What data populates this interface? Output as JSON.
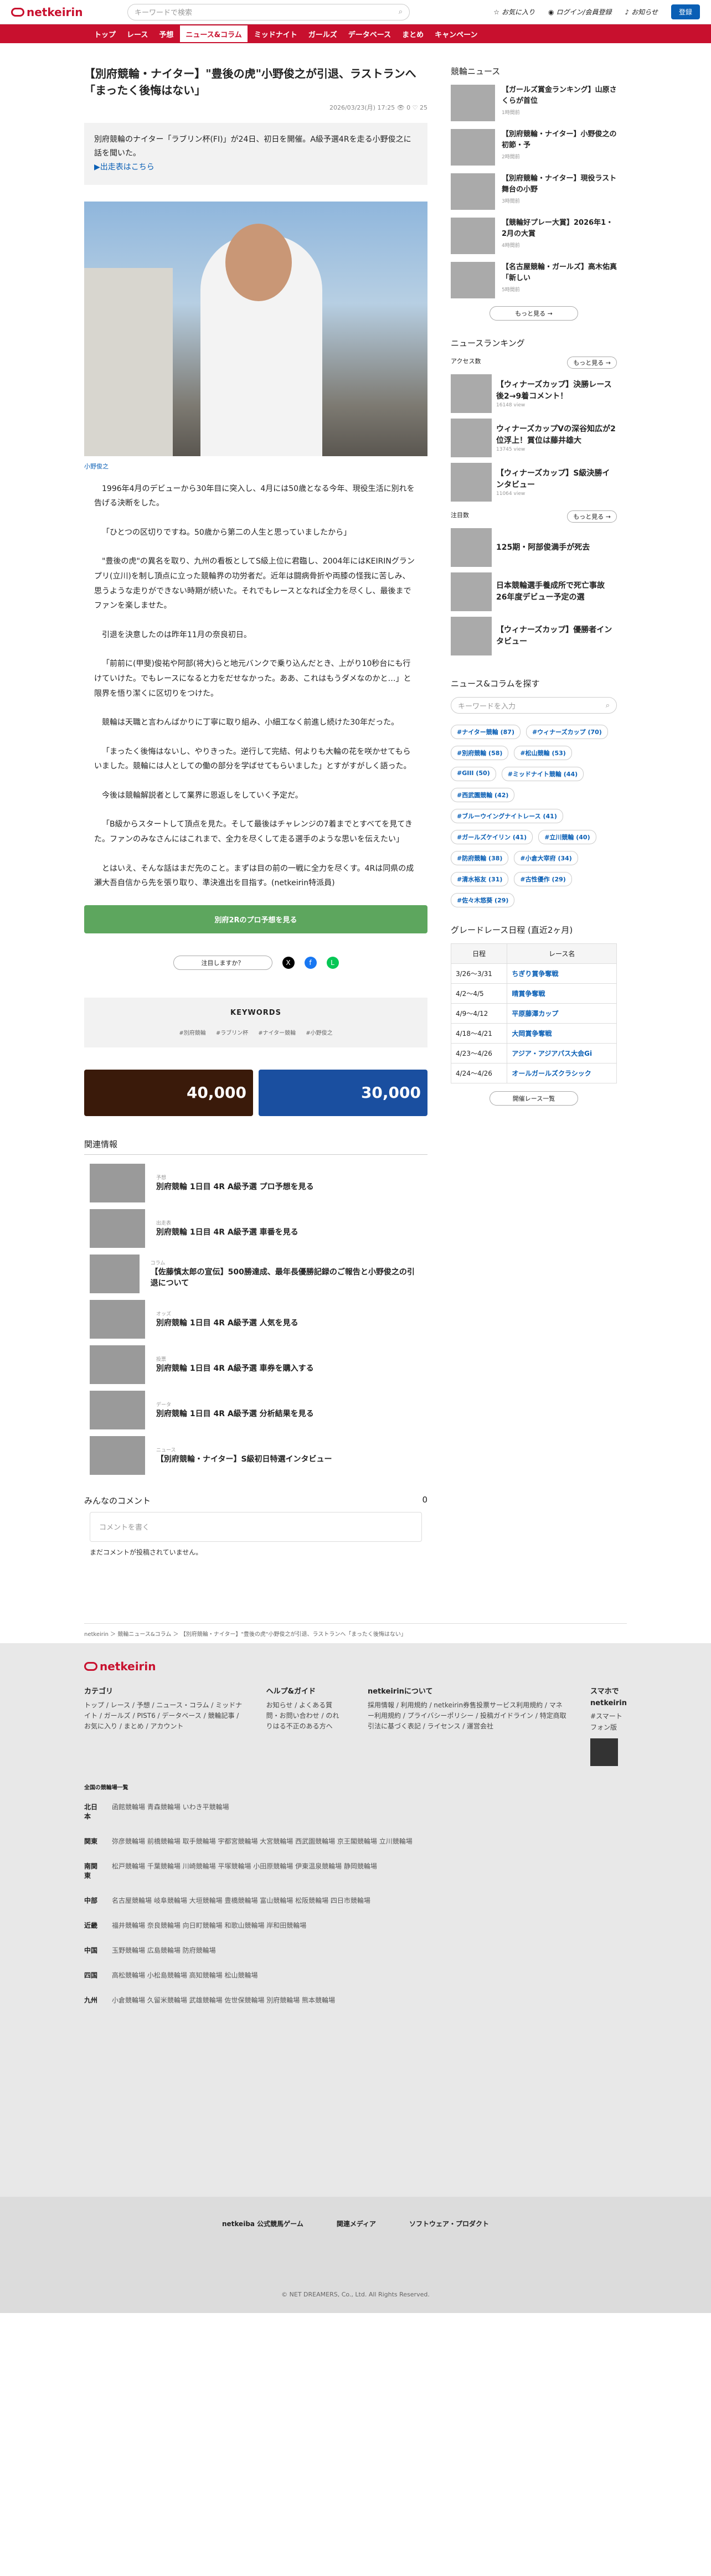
{
  "header": {
    "search_placeholder": "キーワードで検索",
    "fav": "お気に入り",
    "login": "ログイン/会員登録",
    "notice": "お知らせ",
    "register": "登録"
  },
  "nav": [
    "トップ",
    "レース",
    "予想",
    "ニュース&コラム",
    "ミッドナイト",
    "ガールズ",
    "データベース",
    "まとめ",
    "キャンペーン"
  ],
  "article": {
    "title": "【別府競輪・ナイター】\"豊後の虎\"小野俊之が引退、ラストランへ「まったく後悔はない」",
    "date": "2026/03/23(月) 17:25",
    "views": "0",
    "likes": "25",
    "lead": "別府競輪のナイター「ラブリン杯(FI)」が24日、初日を開催。A級予選4Rを走る小野俊之に話を聞いた。",
    "lead_link": "▶出走表はこちら",
    "caption": "小野俊之",
    "paras": [
      "1996年4月のデビューから30年目に突入し、4月には50歳となる今年、現役生活に別れを告げる決断をした。",
      "「ひとつの区切りですね。50歳から第二の人生と思っていましたから」",
      "\"豊後の虎\"の異名を取り、九州の看板としてS級上位に君臨し、2004年にはKEIRINグランプリ(立川)を制し頂点に立った競輪界の功労者だ。近年は闘病骨折や両膝の怪我に苦しみ、思うような走りができない時期が続いた。それでもレースとなれば全力を尽くし、最後までファンを楽しませた。",
      "引退を決意したのは昨年11月の奈良初日。",
      "「前前に(甲斐)俊祐や阿部(将大)らと地元バンクで乗り込んだとき、上がり10秒台にも行けていけた。でもレースになると力をだせなかった。ああ、これはもうダメなのかと…」と限界を悟り潔くに区切りをつけた。",
      "競輪は天職と言わんばかりに丁寧に取り組み、小細工なく前進し続けた30年だった。",
      "「まったく後悔はないし、やりきった。逆行して完結、何よりも大輪の花を咲かせてもらいました。競輪には人としての働の部分を学ばせてもらいました」とすがすがしく語った。",
      "今後は競輪解説者として業界に恩返しをしていく予定だ。",
      "「B級からスタートして頂点を見た。そして最後はチャレンジの7着までとすべてを見てきた。ファンのみなさんにはこれまで、全力を尽くして走る選手のような思いを伝えたい」",
      "とはいえ、そんな話はまだ先のこと。まずは目の前の一戦に全力を尽くす。4Rは同県の成瀬大吾自信から先を張り取り、準決進出を目指す。(netkeirin特派員)"
    ],
    "cta": "別府2Rのプロ予想を見る",
    "share_pill": "注目しますか？",
    "kw_title": "KEYWORDS",
    "keywords": [
      "#別府競輪",
      "#ラブリン杯",
      "#ナイター競輪",
      "#小野俊之"
    ]
  },
  "banners": [
    "40,000",
    "30,000"
  ],
  "related": {
    "title": "関連情報",
    "items": [
      {
        "tag": "予想",
        "t": "別府競輪 1日目 4R A級予選 プロ予想を見る"
      },
      {
        "tag": "出走表",
        "t": "別府競輪 1日目 4R A級予選 車番を見る"
      },
      {
        "tag": "コラム",
        "t": "【佐藤慎太郎の宣伝】500勝達成、最年長優勝記録のご報告と小野俊之の引退について"
      },
      {
        "tag": "オッズ",
        "t": "別府競輪 1日目 4R A級予選 人気を見る"
      },
      {
        "tag": "投票",
        "t": "別府競輪 1日目 4R A級予選 車券を購入する"
      },
      {
        "tag": "データ",
        "t": "別府競輪 1日目 4R A級予選 分析結果を見る"
      },
      {
        "tag": "ニュース",
        "t": "【別府競輪・ナイター】S級初日特選インタビュー"
      }
    ]
  },
  "comments": {
    "title": "みんなのコメント",
    "count": "0",
    "placeholder": "コメントを書く",
    "none": "まだコメントが投稿されていません。"
  },
  "side": {
    "news_title": "競輪ニュース",
    "news": [
      {
        "t": "【ガールズ賞金ランキング】山原さくらが首位",
        "m": "1時間前"
      },
      {
        "t": "【別府競輪・ナイター】小野俊之の初節・予",
        "m": "2時間前"
      },
      {
        "t": "【別府競輪・ナイター】現役ラスト舞台の小野",
        "m": "3時間前"
      },
      {
        "t": "【競輪好プレー大賞】2026年1・2月の大賞",
        "m": "4時間前"
      },
      {
        "t": "【名古屋競輪・ガールズ】高木佑真「新しい",
        "m": "5時間前"
      }
    ],
    "more": "もっと見る →",
    "ranking_title": "ニュースランキング",
    "access": "アクセス数",
    "rank": [
      {
        "t": "【ウィナーズカップ】決勝レース後2→9着コメント！",
        "m": "16148 view"
      },
      {
        "t": "ウィナーズカップVの深谷知広が2位浮上！賞位は藤井雄大",
        "m": "13745 view"
      },
      {
        "t": "【ウィナーズカップ】S級決勝インタビュー",
        "m": "11064 view"
      }
    ],
    "attention": "注目数",
    "att": [
      {
        "t": "125期・阿部俊満手が死去"
      },
      {
        "t": "日本競輪選手養成所で死亡事故 26年度デビュー予定の選"
      },
      {
        "t": "【ウィナーズカップ】優勝者インタビュー"
      }
    ],
    "explore_title": "ニュース&コラムを探す",
    "explore_ph": "キーワードを入力",
    "tags": [
      "#ナイター競輪 (87)",
      "#ウィナーズカップ (70)",
      "#別府競輪 (58)",
      "#松山競輪 (53)",
      "#GIII (50)",
      "#ミッドナイト競輪 (44)",
      "#西武園競輪 (42)",
      "#ブルーウイングナイトレース (41)",
      "#ガールズケイリン (41)",
      "#立川競輪 (40)",
      "#防府競輪 (38)",
      "#小倉大宰府 (34)",
      "#清水裕友 (31)",
      "#古性優作 (29)",
      "#佐々木悠葵 (29)"
    ],
    "grade_title": "グレードレース日程 (直近2ヶ月)",
    "grade_head": [
      "日程",
      "レース名"
    ],
    "grade": [
      [
        "3/26〜3/31",
        "ちぎり賞争奪戦"
      ],
      [
        "4/2〜4/5",
        "晴賞争奪戦"
      ],
      [
        "4/9〜4/12",
        "平原藤澤カップ"
      ],
      [
        "4/18〜4/21",
        "大岡賞争奪戦"
      ],
      [
        "4/23〜4/26",
        "アジア・アジアパス大会Gi"
      ],
      [
        "4/24〜4/26",
        "オールガールズクラシック"
      ]
    ],
    "grade_more": "開催レース一覧"
  },
  "breadcrumb": "netkeirin ＞ 競輪ニュース&コラム ＞ 【別府競輪・ナイター】\"豊後の虎\"小野俊之が引退、ラストランへ「まったく後悔はない」",
  "footer": {
    "cols": [
      {
        "h": "カテゴリ",
        "l": [
          "トップ",
          "レース",
          "予想",
          "ニュース・コラム",
          "ミッドナイト",
          "ガールズ",
          "PIST6",
          "データベース",
          "競輪記事",
          "お気に入り",
          "まとめ",
          "アカウント"
        ]
      },
      {
        "h": "ヘルプ&ガイド",
        "l": [
          "お知らせ",
          "よくある質問・お問い合わせ",
          "のれりはる不正のある方へ"
        ]
      },
      {
        "h": "netkeirinについて",
        "l": [
          "採用情報",
          "利用規約",
          "netkeirin券售投票サービス利用規約",
          "マネー利用規約",
          "プライバシーポリシー",
          "投稿ガイドライン",
          "特定商取引法に基づく表記",
          "ライセンス",
          "運営会社"
        ]
      },
      {
        "h": "スマホでnetkeirin",
        "l": [
          "#スマートフォン版"
        ]
      }
    ],
    "area_title": "全国の競輪場一覧",
    "areas": [
      [
        "北日本",
        "函館競輪場 青森競輪場 いわき平競輪場"
      ],
      [
        "関東",
        "弥彦競輪場 前橋競輪場 取手競輪場 宇都宮競輪場 大宮競輪場 西武園競輪場 京王閣競輪場 立川競輪場"
      ],
      [
        "南関東",
        "松戸競輪場 千葉競輪場 川崎競輪場 平塚競輪場 小田原競輪場 伊東温泉競輪場 静岡競輪場"
      ],
      [
        "中部",
        "名古屋競輪場 岐阜競輪場 大垣競輪場 豊橋競輪場 富山競輪場 松阪競輪場 四日市競輪場"
      ],
      [
        "近畿",
        "福井競輪場 奈良競輪場 向日町競輪場 和歌山競輪場 岸和田競輪場"
      ],
      [
        "中国",
        "玉野競輪場 広島競輪場 防府競輪場"
      ],
      [
        "四国",
        "高松競輪場 小松島競輪場 高知競輪場 松山競輪場"
      ],
      [
        "九州",
        "小倉競輪場 久留米競輪場 武雄競輪場 佐世保競輪場 別府競輪場 熊本競輪場"
      ]
    ],
    "bottom": [
      "netkeiba 公式競馬ゲーム",
      "関連メディア",
      "ソフトウェア・プロダクト"
    ],
    "copy": "© NET DREAMERS, Co., Ltd. All Rights Reserved."
  }
}
